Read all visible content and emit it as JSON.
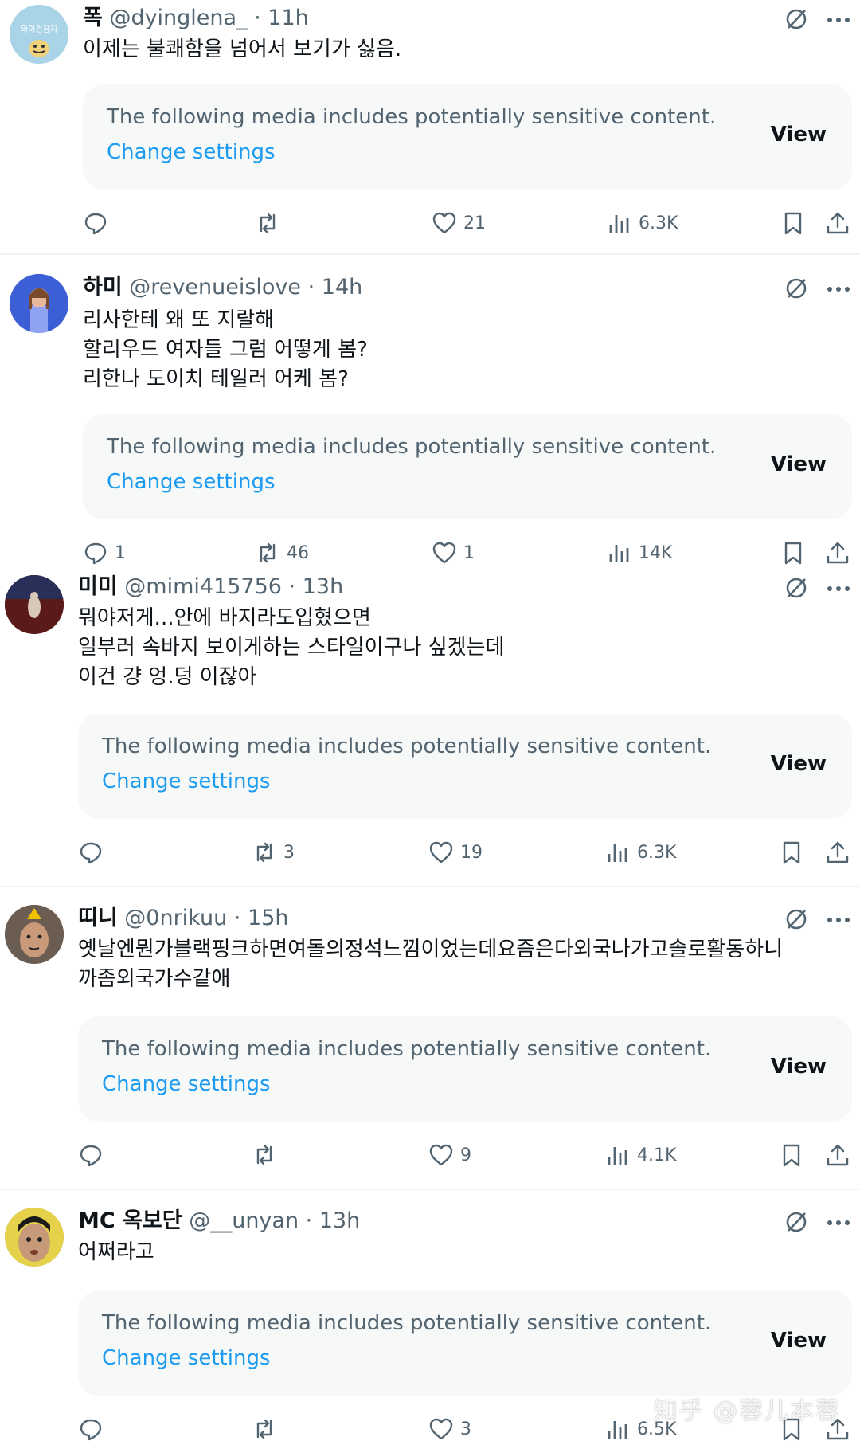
{
  "tweets": [
    {
      "name": "폭",
      "handle": "@dyinglena_",
      "sep": " · ",
      "time": "11h",
      "avatar_label": "와이건참지",
      "text": "이제는 불쾌함을 넘어서 보기가 싫음.",
      "media_warning": "The following media includes potentially sensitive content.",
      "change_settings": "Change settings",
      "view": "View",
      "replies": "",
      "retweets": "",
      "likes": "21",
      "views": "6.3K"
    },
    {
      "name": "하미",
      "handle": "@revenueislove",
      "sep": " · ",
      "time": "14h",
      "avatar_label": "",
      "text": "리사한테 왜 또 지랄해\n할리우드 여자들 그럼 어떻게 봄?\n리한나 도이치 테일러 어케 봄?",
      "media_warning": "The following media includes potentially sensitive content.",
      "change_settings": "Change settings",
      "view": "View",
      "replies": "1",
      "retweets": "46",
      "likes": "1",
      "views": "14K"
    },
    {
      "name": "미미",
      "handle": "@mimi415756",
      "sep": " · ",
      "time": "13h",
      "avatar_label": "",
      "text": "뭐야저게...안에 바지라도입혔으면\n일부러 속바지 보이게하는 스타일이구나 싶겠는데\n이건 걍 엉.덩 이잖아",
      "media_warning": "The following media includes potentially sensitive content.",
      "change_settings": "Change settings",
      "view": "View",
      "replies": "",
      "retweets": "3",
      "likes": "19",
      "views": "6.3K"
    },
    {
      "name": "띠니",
      "handle": "@0nrikuu",
      "sep": " · ",
      "time": "15h",
      "avatar_label": "",
      "text": "옛날엔뭔가블랙핑크하면여돌의정석느낌이었는데요즘은다외국나가고솔로활동하니\n까좀외국가수같애",
      "media_warning": "The following media includes potentially sensitive content.",
      "change_settings": "Change settings",
      "view": "View",
      "replies": "",
      "retweets": "",
      "likes": "9",
      "views": "4.1K"
    },
    {
      "name": "MC 옥보단",
      "handle": "@__unyan",
      "sep": " · ",
      "time": "13h",
      "avatar_label": "",
      "text": "어쩌라고",
      "media_warning": "The following media includes potentially sensitive content.",
      "change_settings": "Change settings",
      "view": "View",
      "replies": "",
      "retweets": "",
      "likes": "3",
      "views": "6.5K"
    }
  ],
  "watermark": "知乎 @蓉儿本蓉",
  "colors": {
    "text": "#0f1419",
    "muted": "#536471",
    "link": "#1d9bf0",
    "media_bg": "#f7f9f9",
    "divider": "#eff3f4"
  },
  "icons": {
    "reply": "reply-icon",
    "retweet": "retweet-icon",
    "like": "heart-icon",
    "views": "views-chart-icon",
    "bookmark": "bookmark-icon",
    "share": "share-icon",
    "grok": "grok-icon",
    "more": "more-icon"
  }
}
